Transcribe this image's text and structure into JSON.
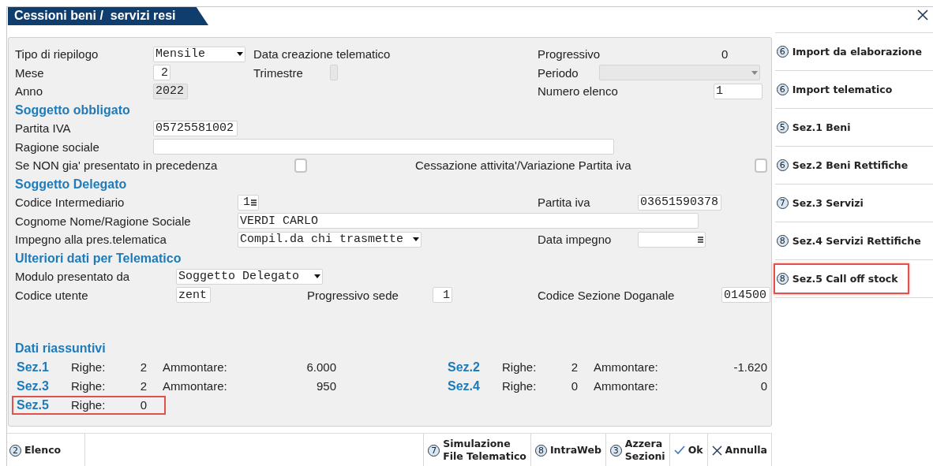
{
  "window": {
    "title": "Cessioni beni /  servizi resi"
  },
  "form": {
    "rows": [
      {
        "kind": "fields",
        "items": [
          {
            "kind": "label",
            "text": "Tipo di riepilogo"
          },
          {
            "kind": "select",
            "value": "Mensile",
            "disabled": false
          },
          {
            "kind": "label",
            "text": "Data creazione telematico"
          },
          {
            "kind": "label",
            "text": "Progressivo"
          },
          {
            "kind": "value",
            "text": "0"
          }
        ]
      },
      {
        "kind": "fields",
        "items": [
          {
            "kind": "label",
            "text": "Mese"
          },
          {
            "kind": "input",
            "value": "2",
            "disabled": false,
            "lookup": false
          },
          {
            "kind": "label",
            "text": "Trimestre"
          },
          {
            "kind": "input",
            "disabled": true,
            "lookup": false
          },
          {
            "kind": "label",
            "text": "Periodo"
          },
          {
            "kind": "select",
            "disabled": true
          }
        ]
      },
      {
        "kind": "fields",
        "items": [
          {
            "kind": "label",
            "text": "Anno"
          },
          {
            "kind": "input",
            "value": "2022",
            "disabled": true,
            "lookup": false
          },
          {
            "kind": "label",
            "text": "Numero elenco"
          },
          {
            "kind": "input",
            "value": "1",
            "disabled": false,
            "lookup": false
          }
        ]
      },
      {
        "kind": "heading",
        "text": "Soggetto obbligato"
      },
      {
        "kind": "fields",
        "items": [
          {
            "kind": "label",
            "text": "Partita IVA"
          },
          {
            "kind": "input",
            "value": "05725581002",
            "disabled": false,
            "lookup": false
          }
        ]
      },
      {
        "kind": "fields",
        "items": [
          {
            "kind": "label",
            "text": "Ragione sociale"
          },
          {
            "kind": "input",
            "disabled": false,
            "lookup": false
          }
        ]
      },
      {
        "kind": "fields",
        "items": [
          {
            "kind": "label",
            "text": "Se NON gia' presentato in precedenza"
          },
          {
            "kind": "checkbox",
            "checked": false
          },
          {
            "kind": "label",
            "text": "Cessazione attivita'/Variazione Partita iva"
          },
          {
            "kind": "checkbox",
            "checked": false
          }
        ]
      },
      {
        "kind": "heading",
        "text": "Soggetto Delegato"
      },
      {
        "kind": "fields",
        "items": [
          {
            "kind": "label",
            "text": "Codice Intermediario"
          },
          {
            "kind": "input",
            "value": "1",
            "disabled": false,
            "lookup": true
          },
          {
            "kind": "label",
            "text": "Partita iva"
          },
          {
            "kind": "input",
            "value": "03651590378",
            "disabled": false,
            "lookup": false
          }
        ]
      },
      {
        "kind": "fields",
        "items": [
          {
            "kind": "label",
            "text": "Cognome Nome/Ragione Sociale"
          },
          {
            "kind": "input",
            "value": "VERDI CARLO",
            "disabled": false,
            "lookup": false
          }
        ]
      },
      {
        "kind": "fields",
        "items": [
          {
            "kind": "label",
            "text": "Impegno alla pres.telematica"
          },
          {
            "kind": "select",
            "value": "Compil.da chi trasmette",
            "disabled": false
          },
          {
            "kind": "label",
            "text": "Data impegno"
          },
          {
            "kind": "input",
            "disabled": false,
            "lookup": true
          }
        ]
      },
      {
        "kind": "heading",
        "text": "Ulteriori dati per Telematico"
      },
      {
        "kind": "fields",
        "items": [
          {
            "kind": "label",
            "text": "Modulo presentato da"
          },
          {
            "kind": "select",
            "value": "Soggetto Delegato",
            "disabled": false
          }
        ]
      },
      {
        "kind": "fields",
        "items": [
          {
            "kind": "label",
            "text": "Codice utente"
          },
          {
            "kind": "input",
            "value": "zent",
            "disabled": false,
            "lookup": false
          },
          {
            "kind": "label",
            "text": "Progressivo sede"
          },
          {
            "kind": "input",
            "value": "1",
            "disabled": false,
            "lookup": false
          },
          {
            "kind": "label",
            "text": "Codice Sezione Doganale"
          },
          {
            "kind": "input",
            "value": "014500",
            "disabled": false,
            "lookup": false
          }
        ]
      }
    ]
  },
  "summary": {
    "title": "Dati riassuntivi",
    "sections": [
      {
        "label": "Sez.1",
        "rows_label": "Righe:",
        "rows": "2",
        "amount_label": "Ammontare:",
        "amount": "6.000",
        "highlighted": false
      },
      {
        "label": "Sez.2",
        "rows_label": "Righe:",
        "rows": "2",
        "amount_label": "Ammontare:",
        "amount": "-1.620",
        "highlighted": false
      },
      {
        "label": "Sez.3",
        "rows_label": "Righe:",
        "rows": "2",
        "amount_label": "Ammontare:",
        "amount": "950",
        "highlighted": false
      },
      {
        "label": "Sez.4",
        "rows_label": "Righe:",
        "rows": "0",
        "amount_label": "Ammontare:",
        "amount": "0",
        "highlighted": false
      },
      {
        "label": "Sez.5",
        "rows_label": "Righe:",
        "rows": "0",
        "highlighted": true
      }
    ]
  },
  "sidebar": {
    "items": [
      {
        "key": "6",
        "label": "Import da elaborazione",
        "highlighted": false
      },
      {
        "key": "6",
        "label": "Import telematico",
        "highlighted": false
      },
      {
        "key": "5",
        "label": "Sez.1 Beni",
        "highlighted": false
      },
      {
        "key": "6",
        "label": "Sez.2 Beni Rettifiche",
        "highlighted": false
      },
      {
        "key": "7",
        "label": "Sez.3 Servizi",
        "highlighted": false
      },
      {
        "key": "8",
        "label": "Sez.4 Servizi Rettifiche",
        "highlighted": false
      },
      {
        "key": "8",
        "label": "Sez.5 Call off stock",
        "highlighted": true
      }
    ]
  },
  "footer": [
    {
      "kind": "key",
      "key": "2",
      "label": "Elenco"
    },
    {
      "kind": "key",
      "key": "7",
      "label": "Simulazione\nFile Telematico"
    },
    {
      "kind": "key",
      "key": "8",
      "label": "IntraWeb"
    },
    {
      "kind": "key",
      "key": "3",
      "label": "Azzera\nSezioni"
    },
    {
      "kind": "ok",
      "label": "Ok"
    },
    {
      "kind": "cancel",
      "label": "Annulla"
    }
  ]
}
